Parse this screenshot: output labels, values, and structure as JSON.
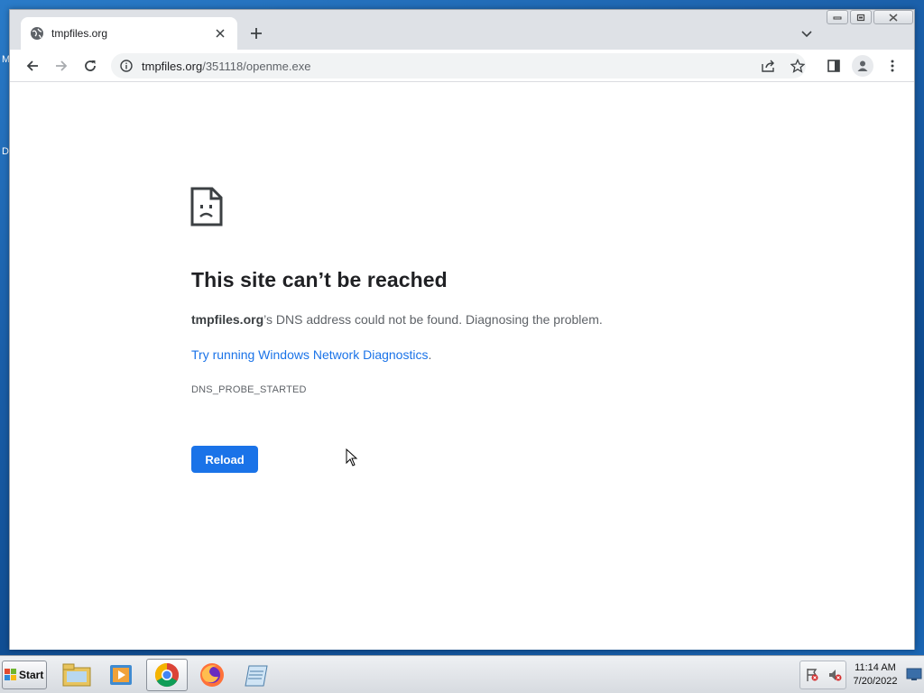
{
  "desktop": {
    "peek_letter_top": "M",
    "peek_letter_mid": "D"
  },
  "browser": {
    "tab": {
      "title": "tmpfiles.org"
    },
    "address": {
      "host": "tmpfiles.org",
      "path": "/351118/openme.exe"
    }
  },
  "error_page": {
    "title": "This site can’t be reached",
    "desc_host": "tmpfiles.org",
    "desc_rest": "’s DNS address could not be found. Diagnosing the problem.",
    "link": "Try running Windows Network Diagnostics",
    "link_suffix": ".",
    "error_code": "DNS_PROBE_STARTED",
    "reload_label": "Reload"
  },
  "taskbar": {
    "start_label": "Start",
    "apps": [
      "file-explorer-icon",
      "media-player-icon",
      "chrome-icon",
      "firefox-icon",
      "notepad-icon"
    ],
    "clock_time": "11:14 AM",
    "clock_date": "7/20/2022"
  },
  "colors": {
    "accent": "#1a73e8",
    "title_text": "#202124",
    "secondary_text": "#5f6368"
  }
}
